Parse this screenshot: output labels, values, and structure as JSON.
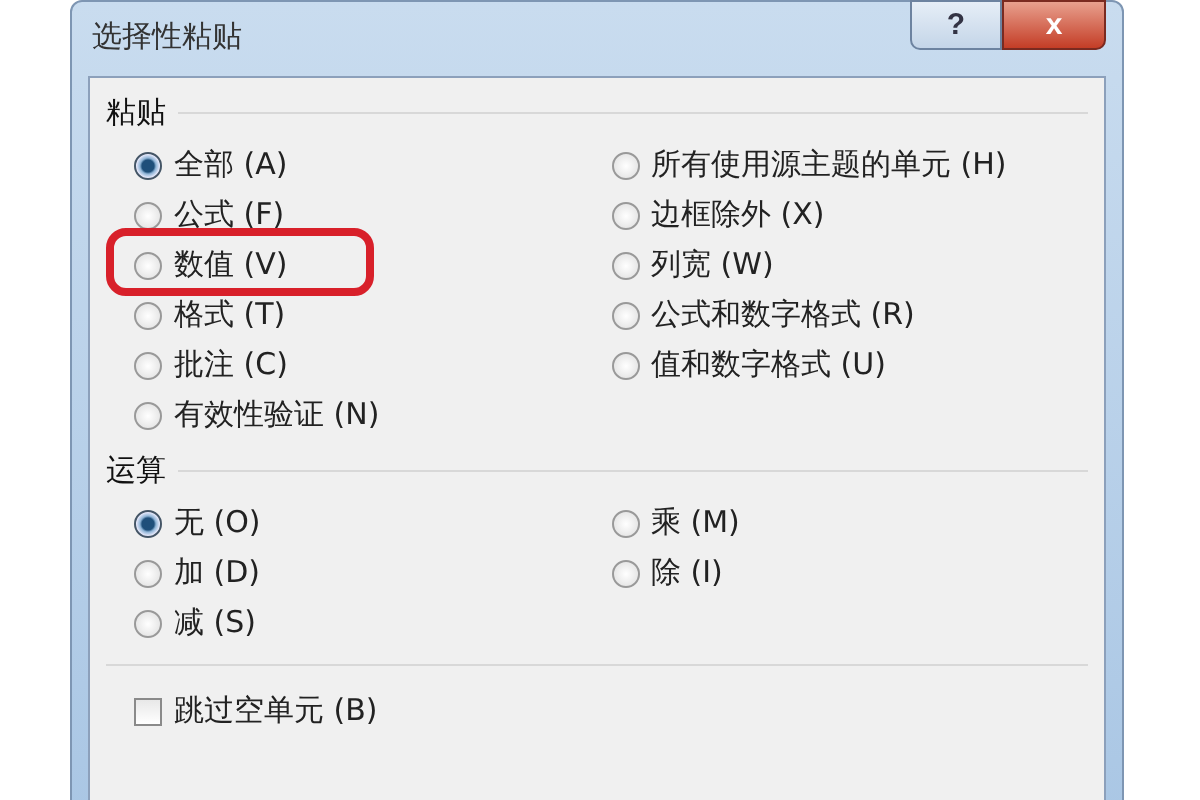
{
  "window": {
    "title": "选择性粘贴",
    "help_button": "?",
    "close_button": "x"
  },
  "paste": {
    "title": "粘贴",
    "options": [
      {
        "label": "全部 (A)",
        "selected": true,
        "highlighted": false
      },
      {
        "label": "公式 (F)",
        "selected": false,
        "highlighted": false
      },
      {
        "label": "数值 (V)",
        "selected": false,
        "highlighted": true
      },
      {
        "label": "格式 (T)",
        "selected": false,
        "highlighted": false
      },
      {
        "label": "批注 (C)",
        "selected": false,
        "highlighted": false
      },
      {
        "label": "有效性验证 (N)",
        "selected": false,
        "highlighted": false
      },
      {
        "label": "所有使用源主题的单元 (H)",
        "selected": false,
        "highlighted": false
      },
      {
        "label": "边框除外 (X)",
        "selected": false,
        "highlighted": false
      },
      {
        "label": "列宽 (W)",
        "selected": false,
        "highlighted": false
      },
      {
        "label": "公式和数字格式 (R)",
        "selected": false,
        "highlighted": false
      },
      {
        "label": "值和数字格式 (U)",
        "selected": false,
        "highlighted": false
      }
    ]
  },
  "operation": {
    "title": "运算",
    "options": [
      {
        "label": "无 (O)",
        "selected": true,
        "highlighted": false
      },
      {
        "label": "加 (D)",
        "selected": false,
        "highlighted": false
      },
      {
        "label": "减 (S)",
        "selected": false,
        "highlighted": false
      },
      {
        "label": "乘 (M)",
        "selected": false,
        "highlighted": false
      },
      {
        "label": "除 (I)",
        "selected": false,
        "highlighted": false
      }
    ]
  },
  "skip_blanks": {
    "label": "跳过空单元 (B)",
    "checked": false
  }
}
